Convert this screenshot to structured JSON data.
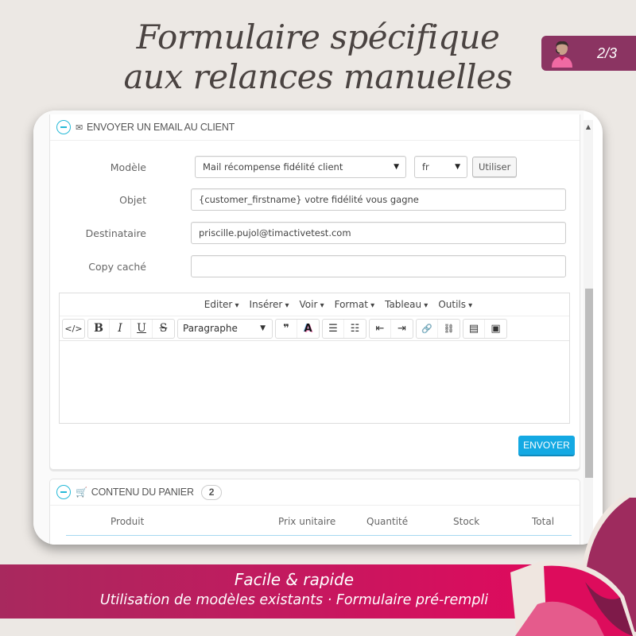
{
  "headline": {
    "line1": "Formulaire spécifique",
    "line2": "aux relances manuelles"
  },
  "page_badge": {
    "icon": "support-agent-icon",
    "text": "2/3"
  },
  "email_panel": {
    "title": "ENVOYER UN EMAIL AU CLIENT",
    "collapse_icon": "minus-circle-icon",
    "title_icon": "envelope-icon",
    "fields": {
      "modele": {
        "label": "Modèle",
        "value": "Mail récompense fidélité client",
        "lang": "fr",
        "use_button": "Utiliser"
      },
      "objet": {
        "label": "Objet",
        "value": "{customer_firstname} votre fidélité vous gagne"
      },
      "destinataire": {
        "label": "Destinataire",
        "value": "priscille.pujol@timactivetest.com"
      },
      "copy_cache": {
        "label": "Copy caché",
        "value": ""
      }
    },
    "editor": {
      "menu": [
        "Editer",
        "Insérer",
        "Voir",
        "Format",
        "Tableau",
        "Outils"
      ],
      "format_select": "Paragraphe",
      "toolbar": {
        "code": "</>",
        "bold": "B",
        "italic": "I",
        "underline": "U",
        "strike": "S",
        "quote": "❞",
        "color": "A",
        "bullet": "☰",
        "numbered": "☷",
        "outdent": "⇤",
        "indent": "⇥",
        "link": "🔗",
        "unlink": "⛓",
        "video": "▤",
        "image": "▣"
      },
      "content": ""
    },
    "send_button": "ENVOYER"
  },
  "cart_panel": {
    "title": "CONTENU DU PANIER",
    "title_icon": "cart-icon",
    "count": "2",
    "columns": [
      "Produit",
      "Prix unitaire",
      "Quantité",
      "Stock",
      "Total"
    ]
  },
  "banner": {
    "line1": "Facile & rapide",
    "line2": "Utilisation de modèles existants · Formulaire pré-rempli"
  },
  "colors": {
    "brand_plum": "#8b3462",
    "accent_blue": "#14a9e3",
    "collapse_blue": "#25b9d7",
    "banner_start": "#a8295e",
    "banner_end": "#df0a5d"
  }
}
